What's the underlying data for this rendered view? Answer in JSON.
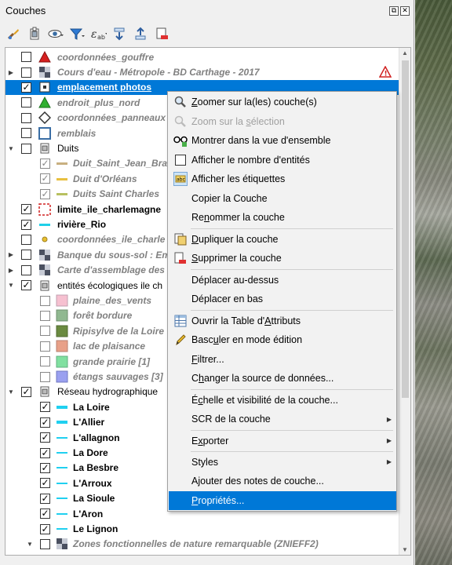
{
  "panel": {
    "title": "Couches"
  },
  "tree": {
    "rows": [
      {
        "label": "coordonnées_gouffre"
      },
      {
        "label": "Cours d'eau - Métropole - BD Carthage - 2017"
      },
      {
        "label": "emplacement photos"
      },
      {
        "label": "endroit_plus_nord"
      },
      {
        "label": "coordonnées_panneaux"
      },
      {
        "label": "remblais"
      },
      {
        "label": "Duits"
      },
      {
        "label": "Duit_Saint_Jean_Bra"
      },
      {
        "label": "Duit d'Orléans"
      },
      {
        "label": "Duits Saint Charles"
      },
      {
        "label": "limite_ile_charlemagne"
      },
      {
        "label": "rivière_Rio"
      },
      {
        "label": "coordonnées_ile_charle"
      },
      {
        "label": "Banque du sous-sol : Em"
      },
      {
        "label": "Carte d'assemblage des"
      },
      {
        "label": "entités écologiques ile ch"
      },
      {
        "label": "plaine_des_vents"
      },
      {
        "label": "forêt bordure"
      },
      {
        "label": "Ripisylve de la Loire"
      },
      {
        "label": "lac de plaisance"
      },
      {
        "label": "grande prairie [1]"
      },
      {
        "label": "étangs sauvages [3]"
      },
      {
        "label": "Réseau hydrographique"
      },
      {
        "label": "La Loire"
      },
      {
        "label": "L'Allier"
      },
      {
        "label": "L'allagnon"
      },
      {
        "label": "La Dore"
      },
      {
        "label": "La Besbre"
      },
      {
        "label": "L'Arroux"
      },
      {
        "label": "La Sioule"
      },
      {
        "label": "L'Aron"
      },
      {
        "label": "Le Lignon"
      },
      {
        "label": "Zones fonctionnelles de nature remarquable (ZNIEFF2)"
      }
    ]
  },
  "menu": {
    "items": [
      {
        "pre": "",
        "u": "Z",
        "post": "oomer sur la(les) couche(s)"
      },
      {
        "pre": "Zoom sur la ",
        "u": "s",
        "post": "élection"
      },
      {
        "pre": "Montrer dans la vue d'ensemble",
        "u": "",
        "post": ""
      },
      {
        "pre": "Afficher le nombre d'entités",
        "u": "",
        "post": ""
      },
      {
        "pre": "Afficher les étiquettes",
        "u": "",
        "post": ""
      },
      {
        "pre": "Copier la Couche",
        "u": "",
        "post": ""
      },
      {
        "pre": "Re",
        "u": "n",
        "post": "ommer la couche"
      },
      {
        "pre": "",
        "u": "D",
        "post": "upliquer la couche"
      },
      {
        "pre": "",
        "u": "S",
        "post": "upprimer la couche"
      },
      {
        "pre": "Déplacer au-dessus",
        "u": "",
        "post": ""
      },
      {
        "pre": "Déplacer en bas",
        "u": "",
        "post": ""
      },
      {
        "pre": "Ouvrir la Table d'",
        "u": "A",
        "post": "ttributs"
      },
      {
        "pre": "Basc",
        "u": "u",
        "post": "ler en mode édition"
      },
      {
        "pre": "",
        "u": "F",
        "post": "iltrer..."
      },
      {
        "pre": "C",
        "u": "h",
        "post": "anger la source de données..."
      },
      {
        "pre": "É",
        "u": "c",
        "post": "helle et visibilité de la couche..."
      },
      {
        "pre": "SCR de la couche",
        "u": "",
        "post": ""
      },
      {
        "pre": "E",
        "u": "x",
        "post": "porter"
      },
      {
        "pre": "Styles",
        "u": "",
        "post": ""
      },
      {
        "pre": "Ajouter des notes de couche...",
        "u": "",
        "post": ""
      },
      {
        "pre": "",
        "u": "P",
        "post": "ropriétés..."
      }
    ]
  },
  "colors": {
    "selection": "#0078d7"
  }
}
